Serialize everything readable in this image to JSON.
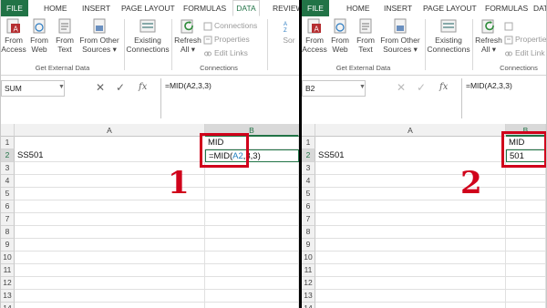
{
  "ribbon_tabs": [
    "FILE",
    "HOME",
    "INSERT",
    "PAGE LAYOUT",
    "FORMULAS",
    "DATA",
    "REVIEW"
  ],
  "ribbon": {
    "access": "From\nAccess",
    "web": "From\nWeb",
    "text": "From\nText",
    "other": "From Other\nSources ▾",
    "existing": "Existing\nConnections",
    "refresh": "Refresh\nAll ▾",
    "group_external": "Get External Data",
    "group_connections": "Connections",
    "connections": "Connections",
    "properties": "Properties",
    "edit_links": "Edit Links",
    "properties_short": "Propertie",
    "edit_links_short": "Edit Link",
    "sort_partial": "Sor",
    "d_partial": "D"
  },
  "formula_bar": {
    "cancel": "✕",
    "enter": "✓",
    "fx": "fx"
  },
  "panel1": {
    "name_box": "SUM",
    "formula": "=MID(A2,3,3)",
    "col_a": "A",
    "col_b": "B",
    "rows": [
      "1",
      "2",
      "3",
      "4",
      "5",
      "6",
      "7",
      "8",
      "9",
      "10",
      "11",
      "12",
      "13",
      "14"
    ],
    "a2": "SS501",
    "b1": "MID",
    "b2_prefix": "=MID(",
    "b2_ref": "A2",
    "b2_suffix": ",3,3)",
    "step": "1"
  },
  "panel2": {
    "name_box": "B2",
    "formula": "=MID(A2,3,3)",
    "col_a": "A",
    "col_b": "B",
    "rows": [
      "1",
      "2",
      "3",
      "4",
      "5",
      "6",
      "7",
      "8",
      "9",
      "10",
      "11",
      "12",
      "13",
      "14"
    ],
    "a2": "SS501",
    "b1": "MID",
    "b2": "501",
    "step": "2"
  },
  "colors": {
    "excel_green": "#217346",
    "highlight_red": "#d0021b",
    "ref_blue": "#1f7fbf"
  }
}
